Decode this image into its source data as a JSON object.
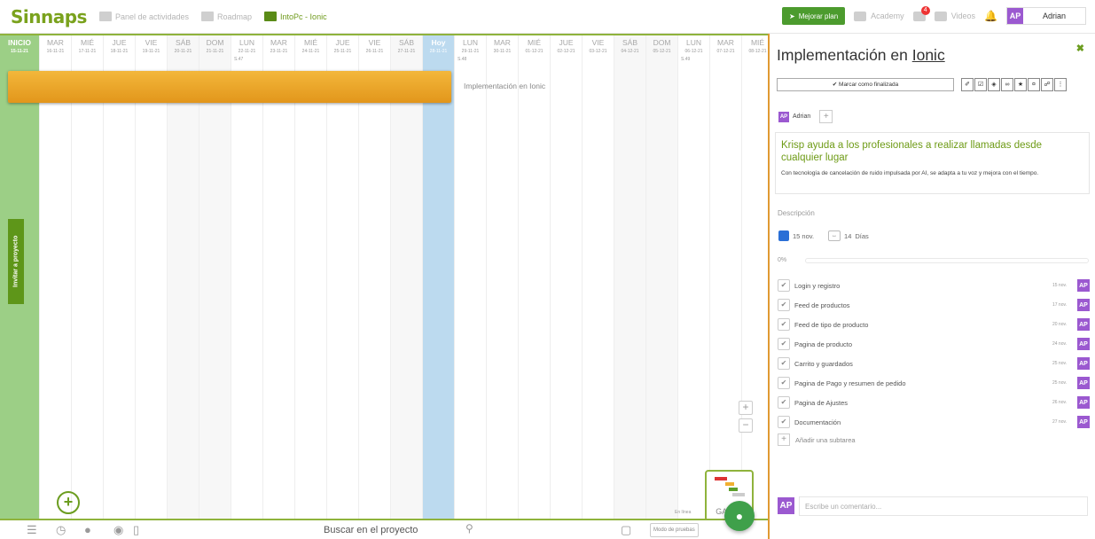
{
  "app": {
    "logo": "Sinnaps",
    "nav": [
      {
        "label": "Panel de actividades"
      },
      {
        "label": "Roadmap"
      },
      {
        "label": "IntoPc - Ionic",
        "active": true
      }
    ]
  },
  "topbar": {
    "upgrade": "Mejorar plan",
    "academy": "Academy",
    "notif_count": "4",
    "videos": "Videos",
    "user_initials": "AP",
    "user_name": "Adrian"
  },
  "timeline": {
    "columns": [
      {
        "name": "INICIO",
        "date": "15-11-21",
        "type": "inicio"
      },
      {
        "name": "MAR",
        "date": "16-11-21"
      },
      {
        "name": "MIÉ",
        "date": "17-11-21"
      },
      {
        "name": "JUE",
        "date": "18-11-21"
      },
      {
        "name": "VIE",
        "date": "19-11-21"
      },
      {
        "name": "SÁB",
        "date": "20-11-21",
        "type": "weekend"
      },
      {
        "name": "DOM",
        "date": "21-11-21",
        "type": "weekend"
      },
      {
        "name": "LUN",
        "date": "22-11-21",
        "week": "S.47"
      },
      {
        "name": "MAR",
        "date": "23-11-21"
      },
      {
        "name": "MIÉ",
        "date": "24-11-21"
      },
      {
        "name": "JUE",
        "date": "25-11-21"
      },
      {
        "name": "VIE",
        "date": "26-11-21"
      },
      {
        "name": "SÁB",
        "date": "27-11-21",
        "type": "weekend"
      },
      {
        "name": "Hoy",
        "date": "28-11-21",
        "type": "hoy"
      },
      {
        "name": "LUN",
        "date": "29-11-21",
        "week": "S.48"
      },
      {
        "name": "MAR",
        "date": "30-11-21"
      },
      {
        "name": "MIÉ",
        "date": "01-12-21"
      },
      {
        "name": "JUE",
        "date": "02-12-21"
      },
      {
        "name": "VIE",
        "date": "03-12-21"
      },
      {
        "name": "SÁB",
        "date": "04-12-21",
        "type": "weekend"
      },
      {
        "name": "DOM",
        "date": "05-12-21",
        "type": "weekend"
      },
      {
        "name": "LUN",
        "date": "06-12-21",
        "week": "S.49"
      },
      {
        "name": "MAR",
        "date": "07-12-21"
      },
      {
        "name": "MIÉ",
        "date": "08-12-21"
      }
    ],
    "task_label": "Implementación en Ionic",
    "invite": "Invitar a proyecto",
    "gantt_label": "GANTT",
    "online": "En línea"
  },
  "bottombar": {
    "search_placeholder": "Buscar en el proyecto",
    "mode": "Modo de pruebas"
  },
  "panel": {
    "title_a": "Implementación en ",
    "title_b": "Ionic",
    "mark_done": "Marcar como finalizada",
    "user_initials": "AP",
    "user_name": "Adrian",
    "ad_title": "Krisp ayuda a los profesionales a realizar llamadas desde cualquier lugar",
    "ad_body": "Con tecnología de cancelación de ruido impulsada por AI, se adapta a tu voz y mejora con el tiempo.",
    "desc_label": "Descripción",
    "start_date": "15 nov.",
    "duration": "14",
    "duration_unit": "Días",
    "progress": "0%",
    "progress_value": 0,
    "subtasks": [
      {
        "name": "Login y registro",
        "date": "15 nov."
      },
      {
        "name": "Feed de productos",
        "date": "17 nov."
      },
      {
        "name": "Feed de tipo de producto",
        "date": "20 nov."
      },
      {
        "name": "Pagina de producto",
        "date": "24 nov."
      },
      {
        "name": "Carrito y guardados",
        "date": "25 nov."
      },
      {
        "name": "Pagina de Pago y  resumen de pedido",
        "date": "25 nov."
      },
      {
        "name": "Pagina de Ajustes",
        "date": "26 nov."
      },
      {
        "name": "Documentación",
        "date": "27 nov."
      }
    ],
    "add_subtask": "Añadir una subtarea",
    "comment_placeholder": "Escribe un comentario..."
  }
}
